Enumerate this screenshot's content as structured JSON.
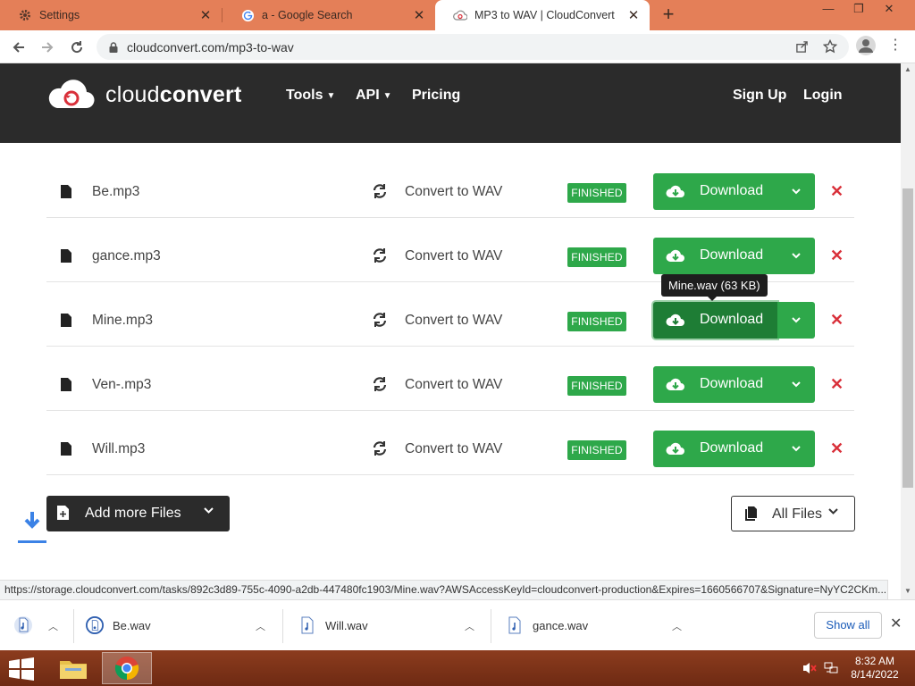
{
  "browser": {
    "tabs": [
      {
        "title": "Settings",
        "icon": "gear-icon",
        "active": false
      },
      {
        "title": "a - Google Search",
        "icon": "google-icon",
        "active": false
      },
      {
        "title": "MP3 to WAV | CloudConvert",
        "icon": "cloudconvert-icon",
        "active": true
      }
    ],
    "new_tab": "+",
    "address": "cloudconvert.com/mp3-to-wav",
    "window_controls": [
      "minimize",
      "restore",
      "close"
    ]
  },
  "site": {
    "logo_light": "cloud",
    "logo_bold": "convert",
    "nav": {
      "tools": "Tools",
      "api": "API",
      "pricing": "Pricing",
      "signup": "Sign Up",
      "login": "Login"
    },
    "accent_green": "#2ea84a",
    "header_bg": "#2b2b2b"
  },
  "files": [
    {
      "name": "Be.mp3",
      "action": "Convert to WAV",
      "status": "FINISHED",
      "download": "Download"
    },
    {
      "name": "gance.mp3",
      "action": "Convert to WAV",
      "status": "FINISHED",
      "download": "Download"
    },
    {
      "name": "Mine.mp3",
      "action": "Convert to WAV",
      "status": "FINISHED",
      "download": "Download"
    },
    {
      "name": "Ven-.mp3",
      "action": "Convert to WAV",
      "status": "FINISHED",
      "download": "Download"
    },
    {
      "name": "Will.mp3",
      "action": "Convert to WAV",
      "status": "FINISHED",
      "download": "Download"
    }
  ],
  "tooltip": "Mine.wav (63 KB)",
  "add_more": "Add more Files",
  "all_files": "All Files",
  "status_url": "https://storage.cloudconvert.com/tasks/892c3d89-755c-4090-a2db-447480fc1903/Mine.wav?AWSAccessKeyId=cloudconvert-production&Expires=1660566707&Signature=NyYC2CKm...",
  "shelf": {
    "items": [
      "Be.wav",
      "Will.wav",
      "gance.wav"
    ],
    "show_all": "Show all"
  },
  "taskbar": {
    "time": "8:32 AM",
    "date": "8/14/2022"
  }
}
